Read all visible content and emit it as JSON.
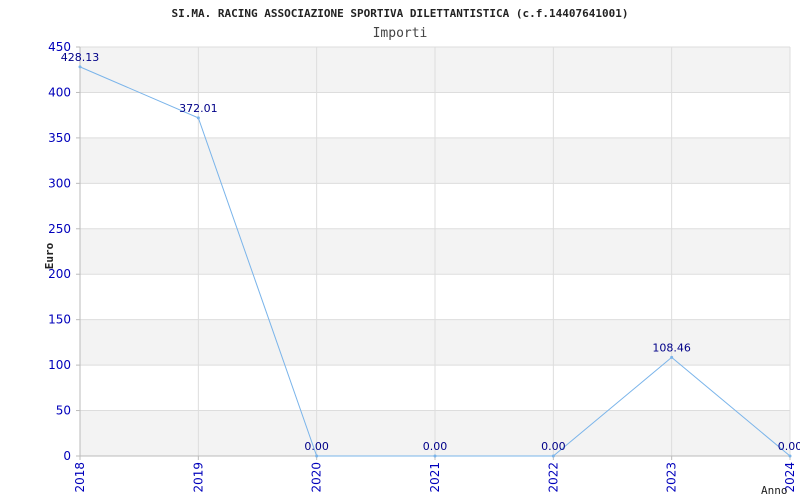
{
  "chart_data": {
    "type": "line",
    "title": "SI.MA. RACING ASSOCIAZIONE SPORTIVA DILETTANTISTICA (c.f.14407641001)",
    "subtitle": "Importi",
    "xlabel": "Anno",
    "ylabel": "Euro",
    "categories": [
      "2018",
      "2019",
      "2020",
      "2021",
      "2022",
      "2023",
      "2024"
    ],
    "values": [
      428.13,
      372.01,
      0,
      0,
      0,
      108.46,
      0
    ],
    "data_labels": [
      "428.13",
      "372.01",
      "0.00",
      "0.00",
      "0.00",
      "108.46",
      "0.00"
    ],
    "yticks": [
      "0",
      "50",
      "100",
      "150",
      "200",
      "250",
      "300",
      "350",
      "400",
      "450"
    ],
    "ylim": [
      0,
      450
    ],
    "grid": true,
    "legend": "none",
    "colors": {
      "line": "#7ab4ea",
      "band": "#f3f3f3",
      "grid": "#dddddd",
      "axis": "#bbbbbb",
      "tick_label": "#0000bb",
      "data_label": "#000088",
      "title": "#222222"
    }
  }
}
